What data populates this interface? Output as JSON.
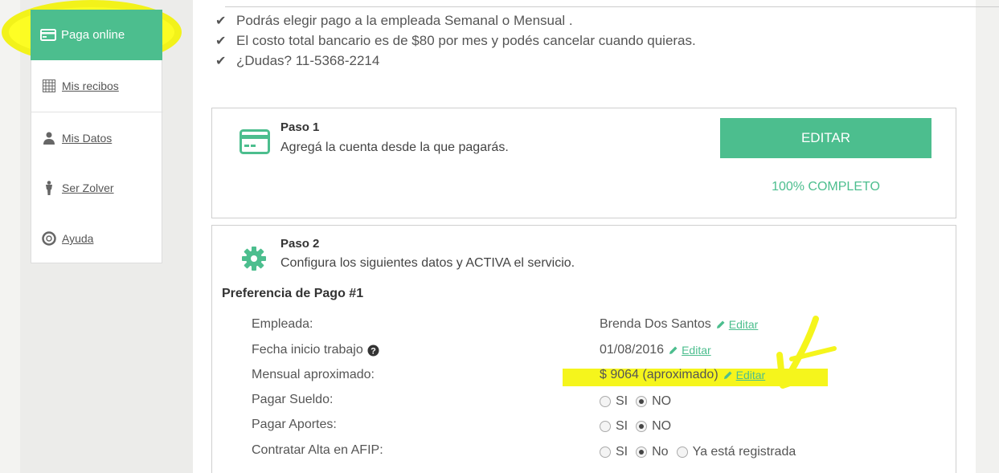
{
  "sidebar": {
    "items": [
      {
        "label": "Paga online",
        "icon": "card-icon",
        "active": true
      },
      {
        "label": "Mis recibos",
        "icon": "calendar-grid-icon"
      },
      {
        "label": "Mis Datos",
        "icon": "user-icon"
      },
      {
        "label": "Ser Zolver",
        "icon": "person-icon"
      },
      {
        "label": "Ayuda",
        "icon": "lifebuoy-icon"
      }
    ]
  },
  "bullets": [
    "Podrás elegir pago a la empleada Semanal o Mensual .",
    "El costo total bancario es de $80 por mes y podés cancelar cuando quieras.",
    "¿Dudas? 11-5368-2214"
  ],
  "paso1": {
    "title": "Paso 1",
    "desc": "Agregá la cuenta desde la que pagarás.",
    "button": "EDITAR",
    "status": "100% COMPLETO"
  },
  "paso2": {
    "title": "Paso 2",
    "desc": "Configura los siguientes datos y ACTIVA el servicio."
  },
  "preferencia": {
    "title": "Preferencia de Pago #1",
    "edit_label": "Editar",
    "rows": [
      {
        "label": "Empleada:",
        "value": "Brenda Dos Santos"
      },
      {
        "label": "Fecha inicio trabajo",
        "value": "01/08/2016"
      },
      {
        "label": "Mensual aproximado:",
        "value": "$ 9064 (aproximado)"
      },
      {
        "label": "Pagar Sueldo:"
      },
      {
        "label": "Pagar Aportes:"
      },
      {
        "label": "Contratar Alta en AFIP:"
      }
    ],
    "options": {
      "si": "SI",
      "no_upper": "NO",
      "no_lower": "No",
      "ya_registrada": "Ya está registrada"
    }
  },
  "colors": {
    "accent": "#4cbe8e",
    "highlight": "#f5f51c"
  }
}
